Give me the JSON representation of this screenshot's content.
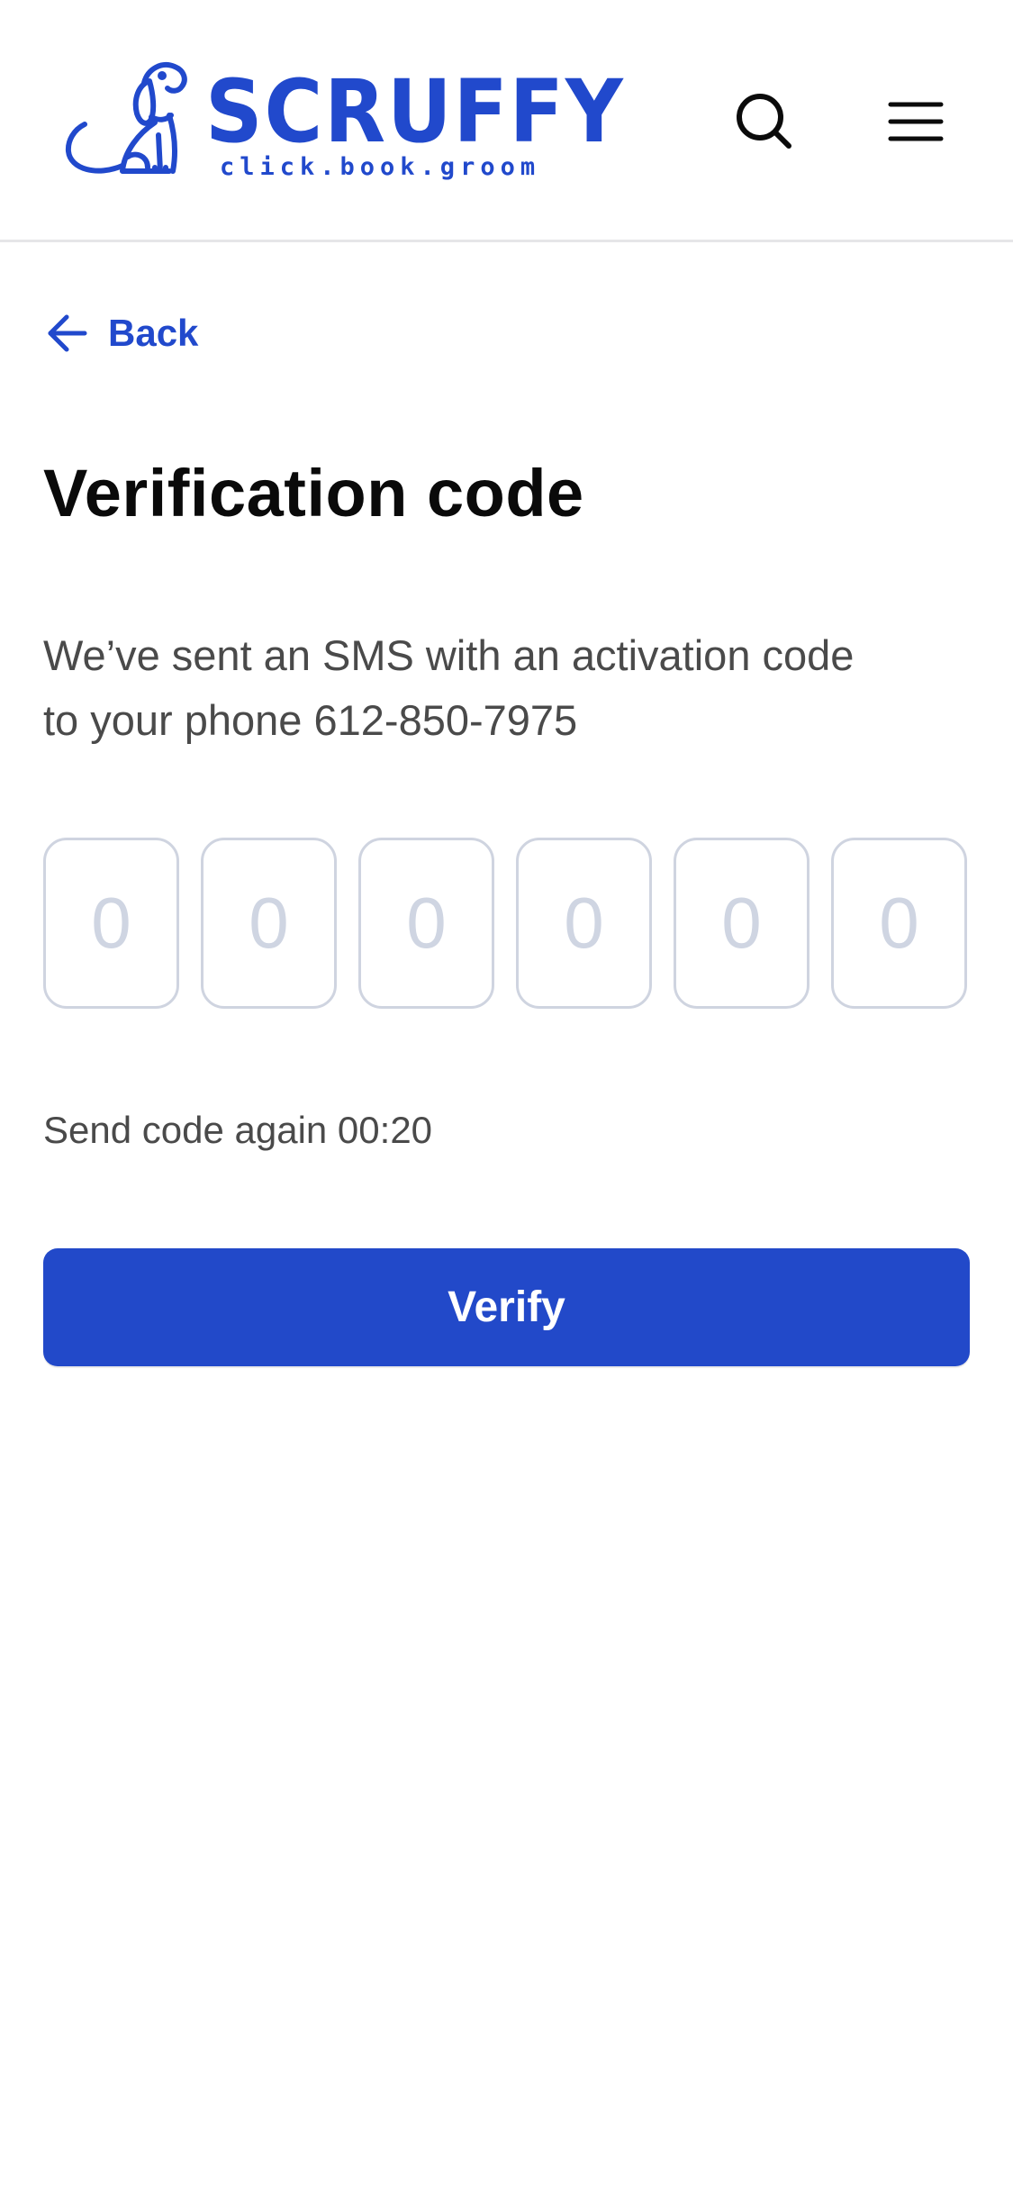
{
  "header": {
    "logo": {
      "wordmark": "SCRUFFY",
      "tagline": "click.book.groom"
    },
    "icons": {
      "search": "search-icon",
      "menu": "hamburger-menu-icon"
    }
  },
  "nav": {
    "back_label": "Back",
    "back_icon": "arrow-left-icon"
  },
  "main": {
    "title": "Verification code",
    "description": "We’ve sent an SMS with an activation code to your phone 612-850-7975",
    "code_inputs": [
      {
        "placeholder": "0",
        "value": ""
      },
      {
        "placeholder": "0",
        "value": ""
      },
      {
        "placeholder": "0",
        "value": ""
      },
      {
        "placeholder": "0",
        "value": ""
      },
      {
        "placeholder": "0",
        "value": ""
      },
      {
        "placeholder": "0",
        "value": ""
      }
    ],
    "resend_text": "Send code again 00:20",
    "verify_label": "Verify"
  },
  "colors": {
    "brand": "#2149cc",
    "button": "#2249c9",
    "text": "#0a0a0a",
    "muted": "#4a4a4a",
    "input_border": "#cfd4e0",
    "placeholder": "#cfd5e2"
  }
}
